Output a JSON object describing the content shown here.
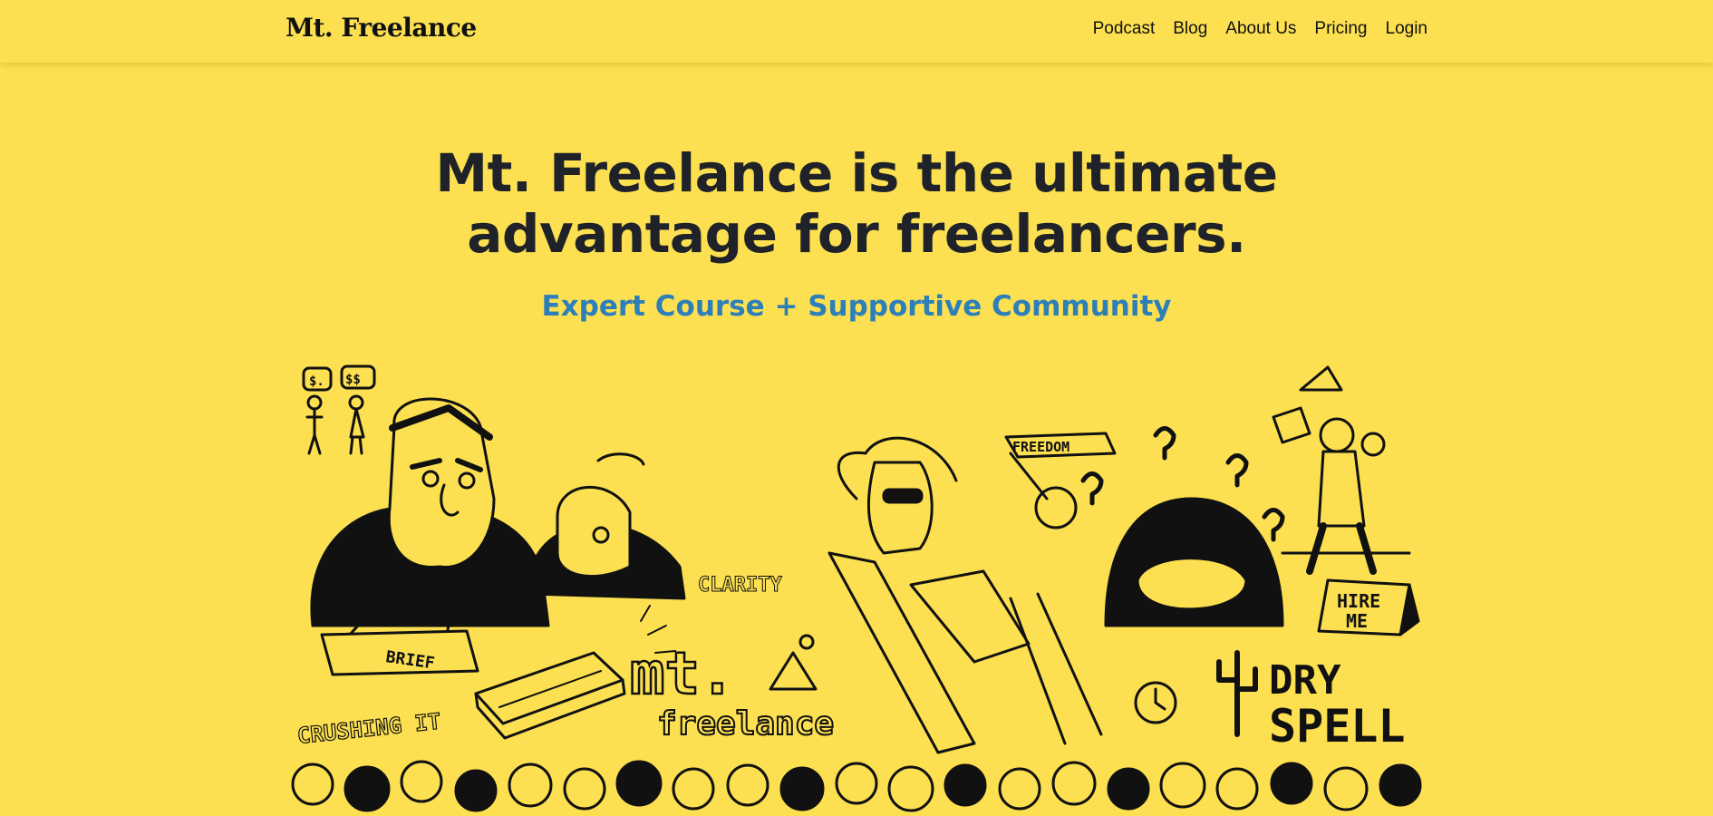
{
  "header": {
    "logo": "Mt. Freelance",
    "nav": [
      "Podcast",
      "Blog",
      "About Us",
      "Pricing",
      "Login"
    ]
  },
  "hero": {
    "title_line1": "Mt. Freelance is the ultimate",
    "title_line2": "advantage for freelancers.",
    "subtitle": "Expert Course + Supportive Community"
  },
  "illustration": {
    "speech1": "$.",
    "speech2": "$$",
    "freedom": "FREEDOM",
    "clarity": "CLARITY",
    "brief": "BRIEF",
    "crushing": "CRUSHING IT",
    "mt": "mt.",
    "freelance": "freelance",
    "hire_me_1": "HIRE",
    "hire_me_2": "ME",
    "dry": "DRY",
    "spell": "SPELL",
    "colors": {
      "ink": "#111111",
      "background": "#FCE051"
    }
  }
}
